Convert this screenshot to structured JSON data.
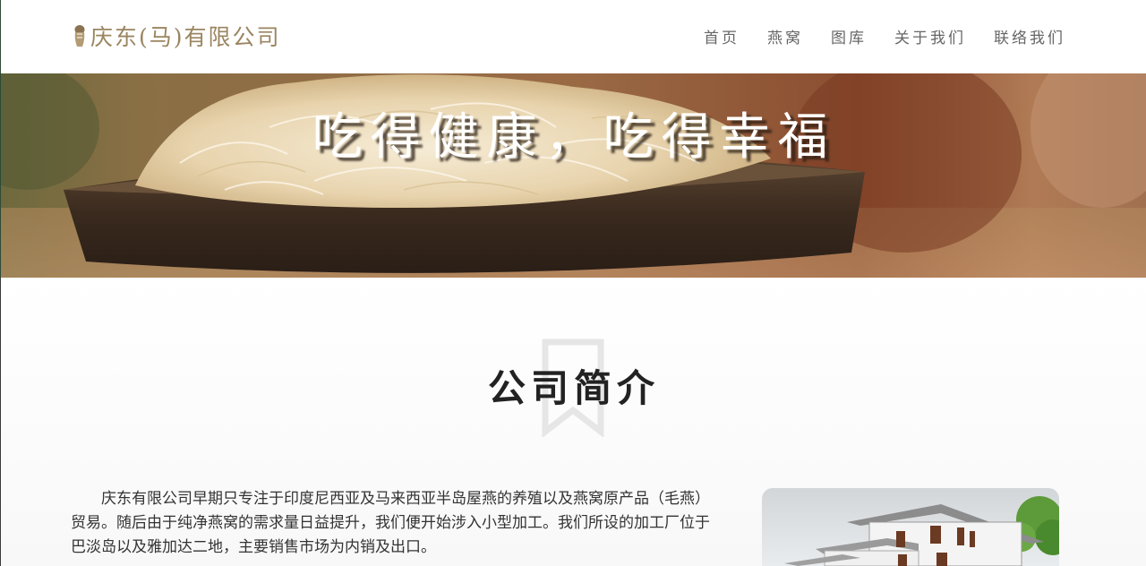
{
  "header": {
    "logo_text": "庆东(马)有限公司",
    "nav": [
      {
        "label": "首页"
      },
      {
        "label": "燕窝"
      },
      {
        "label": "图库"
      },
      {
        "label": "关于我们"
      },
      {
        "label": "联络我们"
      }
    ]
  },
  "hero": {
    "headline": "吃得健康，吃得幸福"
  },
  "intro": {
    "title": "公司简介",
    "paragraph": "庆东有限公司早期只专注于印度尼西亚及马来西亚半岛屋燕的养殖以及燕窝原产品（毛燕）贸易。随后由于纯净燕窝的需求量日益提升，我们便开始涉入小型加工。我们所设的加工厂位于巴淡岛以及雅加达二地，主要销售市场为内销及出口。"
  },
  "colors": {
    "brand_gold": "#9a8560",
    "nav_text": "#666666",
    "title_text": "#222222"
  }
}
